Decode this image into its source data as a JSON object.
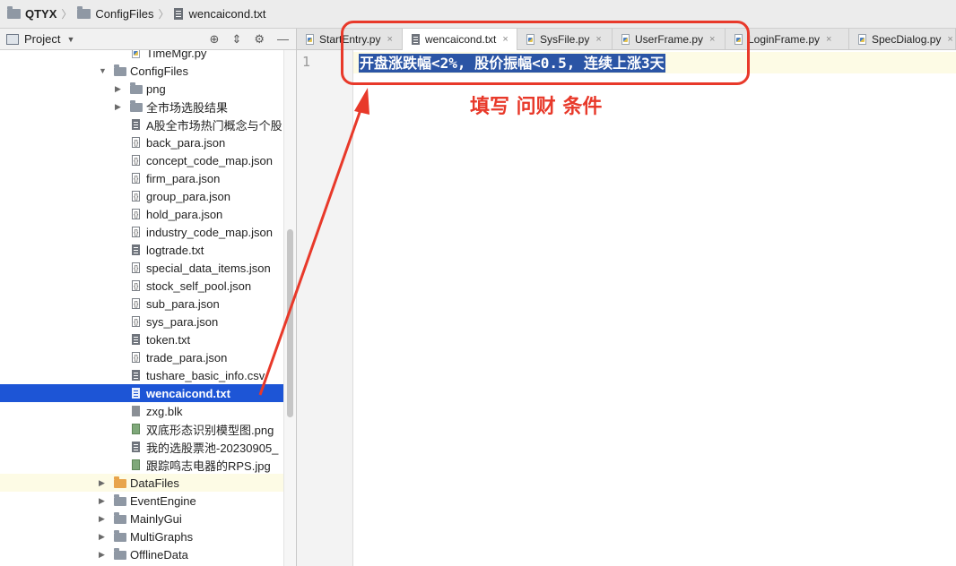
{
  "breadcrumb": {
    "project": "QTYX",
    "folder": "ConfigFiles",
    "file": "wencaicond.txt"
  },
  "project_panel": {
    "title": "Project",
    "icons": [
      "crosshair-icon",
      "collapse-icon",
      "gear-icon",
      "minimize-icon"
    ]
  },
  "tree": [
    {
      "name": "TimeMgr.py",
      "icon": "py",
      "level": 2,
      "kind": "file"
    },
    {
      "name": "ConfigFiles",
      "icon": "folder",
      "level": 1,
      "kind": "folder",
      "expanded": true
    },
    {
      "name": "png",
      "icon": "folder",
      "level": 2,
      "kind": "folder"
    },
    {
      "name": "全市场选股结果",
      "icon": "folder",
      "level": 2,
      "kind": "folder"
    },
    {
      "name": "A股全市场热门概念与个股",
      "icon": "txt",
      "level": 2,
      "kind": "file"
    },
    {
      "name": "back_para.json",
      "icon": "json",
      "level": 2,
      "kind": "file"
    },
    {
      "name": "concept_code_map.json",
      "icon": "json",
      "level": 2,
      "kind": "file"
    },
    {
      "name": "firm_para.json",
      "icon": "json",
      "level": 2,
      "kind": "file"
    },
    {
      "name": "group_para.json",
      "icon": "json",
      "level": 2,
      "kind": "file"
    },
    {
      "name": "hold_para.json",
      "icon": "json",
      "level": 2,
      "kind": "file"
    },
    {
      "name": "industry_code_map.json",
      "icon": "json",
      "level": 2,
      "kind": "file"
    },
    {
      "name": "logtrade.txt",
      "icon": "txt",
      "level": 2,
      "kind": "file"
    },
    {
      "name": "special_data_items.json",
      "icon": "json",
      "level": 2,
      "kind": "file"
    },
    {
      "name": "stock_self_pool.json",
      "icon": "json",
      "level": 2,
      "kind": "file"
    },
    {
      "name": "sub_para.json",
      "icon": "json",
      "level": 2,
      "kind": "file"
    },
    {
      "name": "sys_para.json",
      "icon": "json",
      "level": 2,
      "kind": "file"
    },
    {
      "name": "token.txt",
      "icon": "txt",
      "level": 2,
      "kind": "file"
    },
    {
      "name": "trade_para.json",
      "icon": "json",
      "level": 2,
      "kind": "file"
    },
    {
      "name": "tushare_basic_info.csv",
      "icon": "txt",
      "level": 2,
      "kind": "file"
    },
    {
      "name": "wencaicond.txt",
      "icon": "txt",
      "level": 2,
      "kind": "file",
      "selected": true
    },
    {
      "name": "zxg.blk",
      "icon": "file",
      "level": 2,
      "kind": "file"
    },
    {
      "name": "双底形态识别模型图.png",
      "icon": "img",
      "level": 2,
      "kind": "file"
    },
    {
      "name": "我的选股票池-20230905_",
      "icon": "txt",
      "level": 2,
      "kind": "file"
    },
    {
      "name": "跟踪鸣志电器的RPS.jpg",
      "icon": "img",
      "level": 2,
      "kind": "file"
    },
    {
      "name": "DataFiles",
      "icon": "folder-orange",
      "level": 1,
      "kind": "folder",
      "highlighted": true
    },
    {
      "name": "EventEngine",
      "icon": "folder",
      "level": 1,
      "kind": "folder"
    },
    {
      "name": "MainlyGui",
      "icon": "folder",
      "level": 1,
      "kind": "folder"
    },
    {
      "name": "MultiGraphs",
      "icon": "folder",
      "level": 1,
      "kind": "folder"
    },
    {
      "name": "OfflineData",
      "icon": "folder",
      "level": 1,
      "kind": "folder"
    }
  ],
  "tabs": [
    {
      "label": "StartEntry.py",
      "icon": "py"
    },
    {
      "label": "wencaicond.txt",
      "icon": "txt",
      "active": true
    },
    {
      "label": "SysFile.py",
      "icon": "py"
    },
    {
      "label": "UserFrame.py",
      "icon": "py"
    },
    {
      "label": "LoginFrame.py",
      "icon": "py"
    },
    {
      "label": "SpecDialog.py",
      "icon": "py"
    }
  ],
  "tab_close_glyph": "×",
  "editor": {
    "line_number": "1",
    "code": "开盘涨跌幅<2%, 股价振幅<0.5, 连续上涨3天"
  },
  "annotation": {
    "text": "填写 问财 条件",
    "color": "#e8392a"
  },
  "colors": {
    "selection": "#1d55d6",
    "code_selection": "#2b55a5",
    "current_line": "#fdfbe5"
  }
}
